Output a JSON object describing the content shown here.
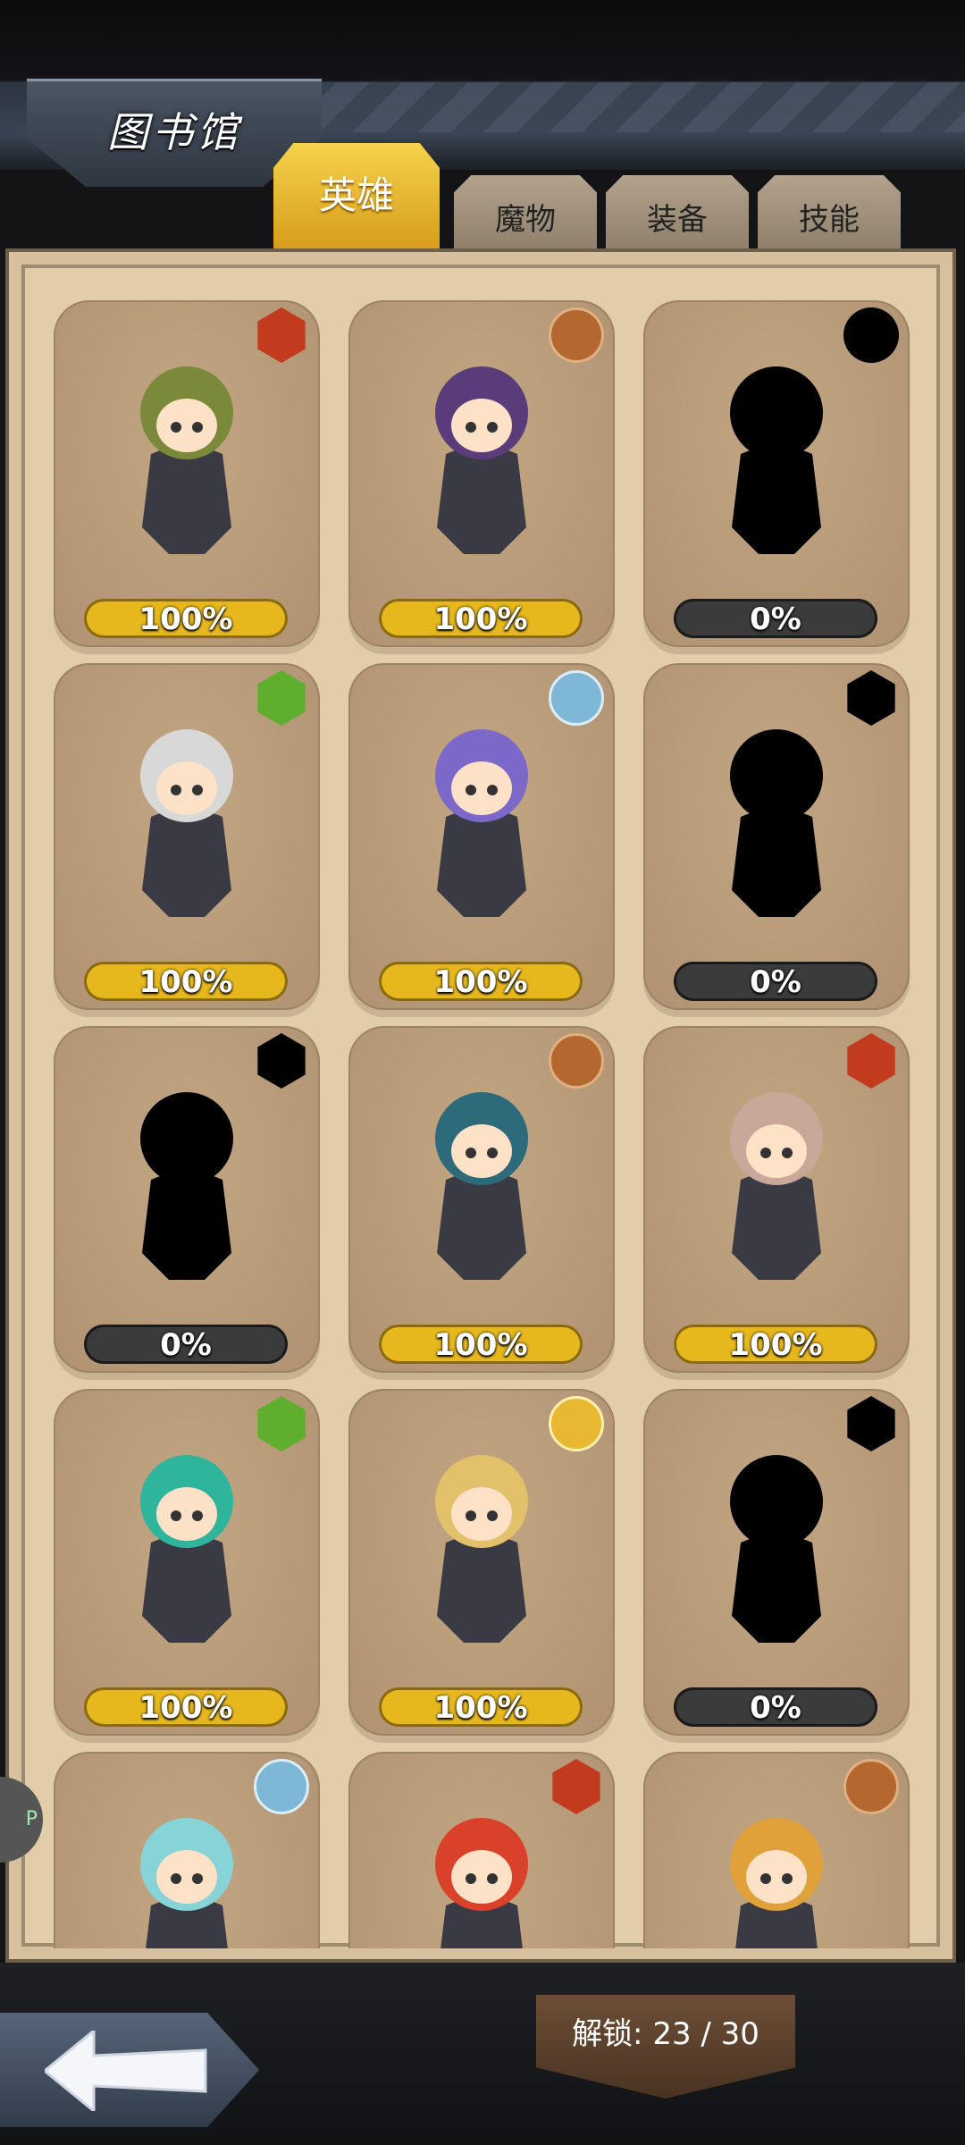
{
  "header": {
    "title": "图书馆"
  },
  "tabs": [
    {
      "label": "英雄",
      "active": true
    },
    {
      "label": "魔物",
      "active": false
    },
    {
      "label": "装备",
      "active": false
    },
    {
      "label": "技能",
      "active": false
    }
  ],
  "heroes": [
    {
      "progress": "100%",
      "element": "fire",
      "unlocked": true,
      "color": "#7a8a3a"
    },
    {
      "progress": "100%",
      "element": "earth",
      "unlocked": true,
      "color": "#5b3c7a"
    },
    {
      "progress": "0%",
      "element": "dark",
      "unlocked": false
    },
    {
      "progress": "100%",
      "element": "wood",
      "unlocked": true,
      "color": "#d8d8d8"
    },
    {
      "progress": "100%",
      "element": "water",
      "unlocked": true,
      "color": "#7b68c9"
    },
    {
      "progress": "0%",
      "element": "dark",
      "unlocked": false
    },
    {
      "progress": "0%",
      "element": "dark",
      "unlocked": false
    },
    {
      "progress": "100%",
      "element": "earth",
      "unlocked": true,
      "color": "#2d6a7a"
    },
    {
      "progress": "100%",
      "element": "fire",
      "unlocked": true,
      "color": "#c9a89a"
    },
    {
      "progress": "100%",
      "element": "wood",
      "unlocked": true,
      "color": "#2eb59c"
    },
    {
      "progress": "100%",
      "element": "light",
      "unlocked": true,
      "color": "#e3c06a"
    },
    {
      "progress": "0%",
      "element": "dark",
      "unlocked": false
    },
    {
      "progress": "",
      "element": "water",
      "unlocked": true,
      "color": "#86d3d8"
    },
    {
      "progress": "",
      "element": "fire",
      "unlocked": true,
      "color": "#d9412a"
    },
    {
      "progress": "",
      "element": "earth",
      "unlocked": true,
      "color": "#e0a03a"
    }
  ],
  "footer": {
    "unlock_label": "解锁: 23 / 30"
  },
  "side_badge": "P"
}
